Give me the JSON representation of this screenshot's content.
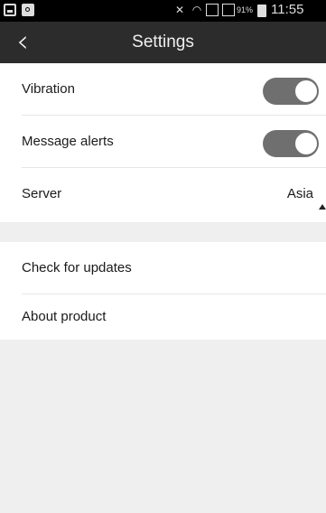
{
  "status_bar": {
    "battery_percent": "91%",
    "time": "11:55",
    "icons": [
      "notification-icon",
      "search-icon",
      "mute-icon",
      "wifi-icon",
      "signal-icon",
      "signal-icon",
      "battery-icon"
    ]
  },
  "header": {
    "title": "Settings",
    "back_icon": "chevron-left-icon"
  },
  "settings": {
    "vibration": {
      "label": "Vibration",
      "enabled": true
    },
    "message_alerts": {
      "label": "Message alerts",
      "enabled": true
    },
    "server": {
      "label": "Server",
      "value": "Asia"
    }
  },
  "more": {
    "check_updates": "Check for updates",
    "about": "About product"
  },
  "colors": {
    "status_bar_bg": "#000000",
    "title_bar_bg": "#2c2c2c",
    "toggle_bg": "#6f6f6f",
    "page_bg": "#efefef"
  }
}
